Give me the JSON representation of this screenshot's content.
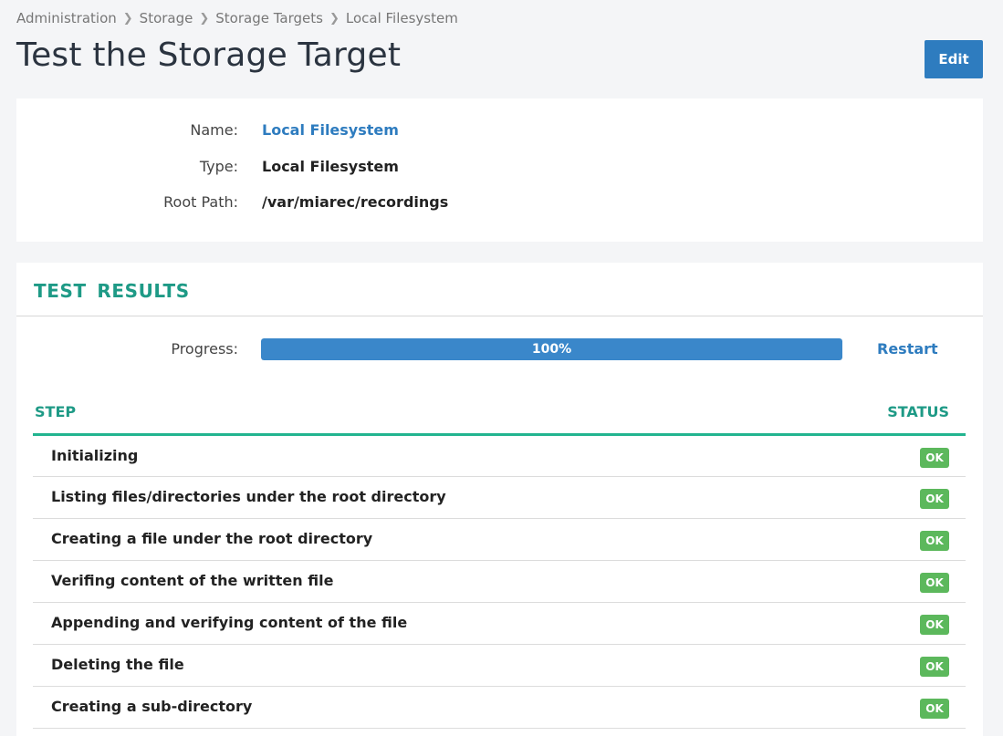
{
  "breadcrumb": [
    "Administration",
    "Storage",
    "Storage Targets",
    "Local Filesystem"
  ],
  "page_title": "Test the Storage Target",
  "edit_label": "Edit",
  "info": {
    "name_label": "Name:",
    "name_value": "Local Filesystem",
    "type_label": "Type:",
    "type_value": "Local Filesystem",
    "root_label": "Root Path:",
    "root_value": "/var/miarec/recordings"
  },
  "results": {
    "title": "TEST RESULTS",
    "progress_label": "Progress:",
    "progress_text": "100%",
    "progress_value": 100,
    "restart_label": "Restart",
    "col_step": "STEP",
    "col_status": "STATUS",
    "rows": [
      {
        "step": "Initializing",
        "status": "OK"
      },
      {
        "step": "Listing files/directories under the root directory",
        "status": "OK"
      },
      {
        "step": "Creating a file under the root directory",
        "status": "OK"
      },
      {
        "step": "Verifing content of the written file",
        "status": "OK"
      },
      {
        "step": "Appending and verifying content of the file",
        "status": "OK"
      },
      {
        "step": "Deleting the file",
        "status": "OK"
      },
      {
        "step": "Creating a sub-directory",
        "status": "OK"
      }
    ]
  },
  "colors": {
    "accent": "#2e7cbf",
    "teal": "#1e9a86",
    "ok": "#5cb85c"
  }
}
